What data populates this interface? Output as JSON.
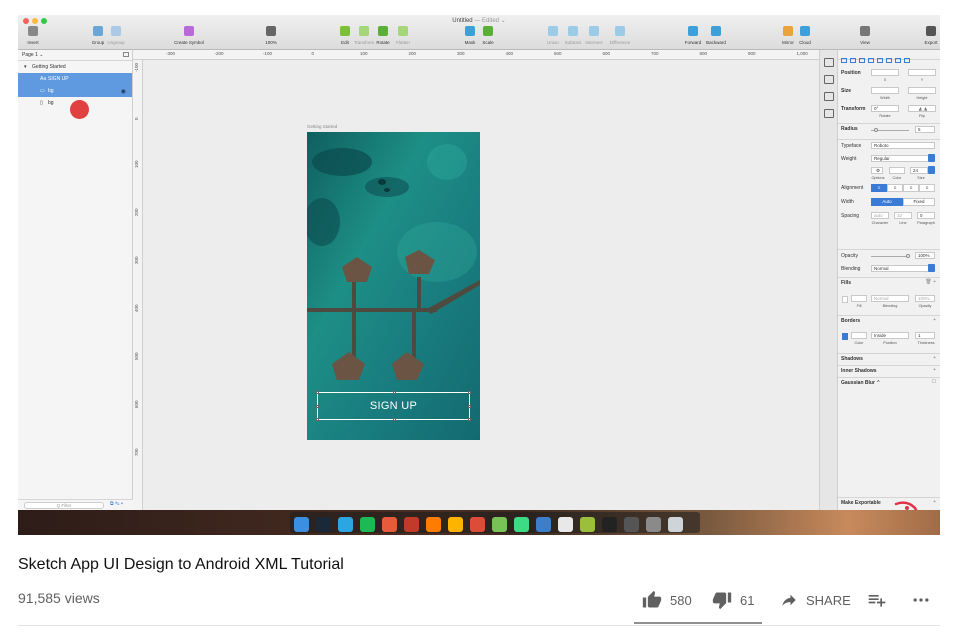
{
  "sketch": {
    "window_title": "Untitled",
    "window_title_status": "— Edited ⌄",
    "toolbar": [
      {
        "label": "Insert",
        "icon": "insert-icon",
        "color": "#888888",
        "dim": false
      },
      {
        "label": "Group",
        "icon": "group-icon",
        "color": "#6aa6d8",
        "dim": false
      },
      {
        "label": "Ungroup",
        "icon": "ungroup-icon",
        "color": "#a9c9e6",
        "dim": true
      },
      {
        "label": "Create Symbol",
        "icon": "symbol-icon",
        "color": "#b86ad8",
        "dim": false
      },
      {
        "label": "100%",
        "icon": "zoom-icon",
        "color": "#666666",
        "dim": false
      },
      {
        "label": "Edit",
        "icon": "edit-icon",
        "color": "#7cbf3a",
        "dim": false
      },
      {
        "label": "Transform",
        "icon": "transform-icon",
        "color": "#a5d67a",
        "dim": true
      },
      {
        "label": "Rotate",
        "icon": "rotate-icon",
        "color": "#5ab036",
        "dim": false
      },
      {
        "label": "Flatten",
        "icon": "flatten-icon",
        "color": "#a5d67a",
        "dim": true
      },
      {
        "label": "Mask",
        "icon": "mask-icon",
        "color": "#3ea0d8",
        "dim": false
      },
      {
        "label": "Scale",
        "icon": "scale-icon",
        "color": "#5ab036",
        "dim": false
      },
      {
        "label": "Union",
        "icon": "union-icon",
        "color": "#9ccbe8",
        "dim": true
      },
      {
        "label": "Subtract",
        "icon": "subtract-icon",
        "color": "#9ccbe8",
        "dim": true
      },
      {
        "label": "Intersect",
        "icon": "intersect-icon",
        "color": "#9ccbe8",
        "dim": true
      },
      {
        "label": "Difference",
        "icon": "difference-icon",
        "color": "#9ccbe8",
        "dim": true
      },
      {
        "label": "Forward",
        "icon": "forward-icon",
        "color": "#3ea0d8",
        "dim": false
      },
      {
        "label": "Backward",
        "icon": "backward-icon",
        "color": "#3ea0d8",
        "dim": false
      },
      {
        "label": "Mirror",
        "icon": "mirror-icon",
        "color": "#e8a33a",
        "dim": false
      },
      {
        "label": "Cloud",
        "icon": "cloud-icon",
        "color": "#3ea0d8",
        "dim": false
      },
      {
        "label": "View",
        "icon": "view-icon",
        "color": "#777777",
        "dim": false
      },
      {
        "label": "Export",
        "icon": "export-icon",
        "color": "#555555",
        "dim": false
      }
    ],
    "layers": {
      "page": "Page 1 ⌄",
      "items": [
        {
          "label": "Getting Started",
          "icon": "▾",
          "selected": false,
          "indent": 0
        },
        {
          "label": "SIGN UP",
          "icon": "Aa",
          "selected": true,
          "indent": 1
        },
        {
          "label": "bg",
          "icon": "▭",
          "selected": true,
          "indent": 1
        },
        {
          "label": "bg",
          "icon": "▯",
          "selected": false,
          "indent": 1
        }
      ],
      "filter_placeholder": "Q Filter"
    },
    "ruler_top": [
      "-300",
      "-200",
      "-100",
      "0",
      "100",
      "200",
      "300",
      "400",
      "500",
      "600",
      "700",
      "800",
      "900",
      "1,000"
    ],
    "ruler_left": [
      "-100",
      "0",
      "100",
      "200",
      "300",
      "400",
      "500",
      "600",
      "700"
    ],
    "artboard": {
      "name": "Getting Started",
      "button_text": "SIGN UP"
    },
    "inspector": {
      "position_label": "Position",
      "x_label": "X",
      "y_label": "Y",
      "size_label": "Size",
      "width_label": "Width",
      "height_label": "Height",
      "transform_label": "Transform",
      "rotate_value": "0°",
      "rotate_label": "Rotate",
      "flip_label": "Flip",
      "radius_label": "Radius",
      "radius_value": "5",
      "typeface_label": "Typeface",
      "typeface_value": "Roboto",
      "weight_label": "Weight",
      "weight_value": "Regular",
      "options_label": "Options",
      "color_label": "Color",
      "font_size_value": "24",
      "size_sub_label": "Size",
      "alignment_label": "Alignment",
      "width_mode_label": "Width",
      "width_auto": "Auto",
      "width_fixed": "Fixed",
      "spacing_label": "Spacing",
      "spacing_char": "auto",
      "spacing_line": "32",
      "spacing_para": "0",
      "character_label": "Character",
      "line_label": "Line",
      "paragraph_label": "Paragraph",
      "opacity_label": "Opacity",
      "opacity_value": "100%",
      "blending_label": "Blending",
      "blending_value": "Normal",
      "fills_label": "Fills",
      "fill_mode": "Normal",
      "fill_opacity": "100%",
      "fill_sub": "Fill",
      "fill_blending_sub": "Blending",
      "fill_opacity_sub": "Opacity",
      "borders_label": "Borders",
      "border_position": "Inside",
      "border_thickness": "1",
      "border_color_sub": "Color",
      "border_position_sub": "Position",
      "border_thickness_sub": "Thickness",
      "shadows_label": "Shadows",
      "inner_shadows_label": "Inner Shadows",
      "blur_label": "Gaussian Blur ⌃",
      "make_exportable": "Make Exportable"
    },
    "dock_icons": [
      {
        "name": "finder-icon",
        "color": "#3c8ee0"
      },
      {
        "name": "steam-icon",
        "color": "#1b2838"
      },
      {
        "name": "telegram-icon",
        "color": "#2ca5e0"
      },
      {
        "name": "spotify-icon",
        "color": "#1db954"
      },
      {
        "name": "books-icon",
        "color": "#e85a3c"
      },
      {
        "name": "photo-booth-icon",
        "color": "#c23a2a"
      },
      {
        "name": "illustrator-icon",
        "color": "#ff7c00"
      },
      {
        "name": "sketch-icon",
        "color": "#fdb300"
      },
      {
        "name": "chrome-icon",
        "color": "#dd4b39"
      },
      {
        "name": "android-studio-icon",
        "color": "#78c257"
      },
      {
        "name": "android-icon",
        "color": "#3ddc84"
      },
      {
        "name": "app-icon",
        "color": "#3d7ecb"
      },
      {
        "name": "calendar-icon",
        "color": "#e8e8e8"
      },
      {
        "name": "genymotion-icon",
        "color": "#9bbf3b"
      },
      {
        "name": "terminal-icon",
        "color": "#222222"
      },
      {
        "name": "utility-icon",
        "color": "#555555"
      },
      {
        "name": "settings-icon",
        "color": "#8a8a8a"
      },
      {
        "name": "trash-icon",
        "color": "#cfd4d8"
      }
    ]
  },
  "youtube": {
    "title": "Sketch App UI Design to Android XML Tutorial",
    "views": "91,585 views",
    "likes": "580",
    "dislikes": "61",
    "share_label": "SHARE",
    "like_ratio": 0.905
  }
}
